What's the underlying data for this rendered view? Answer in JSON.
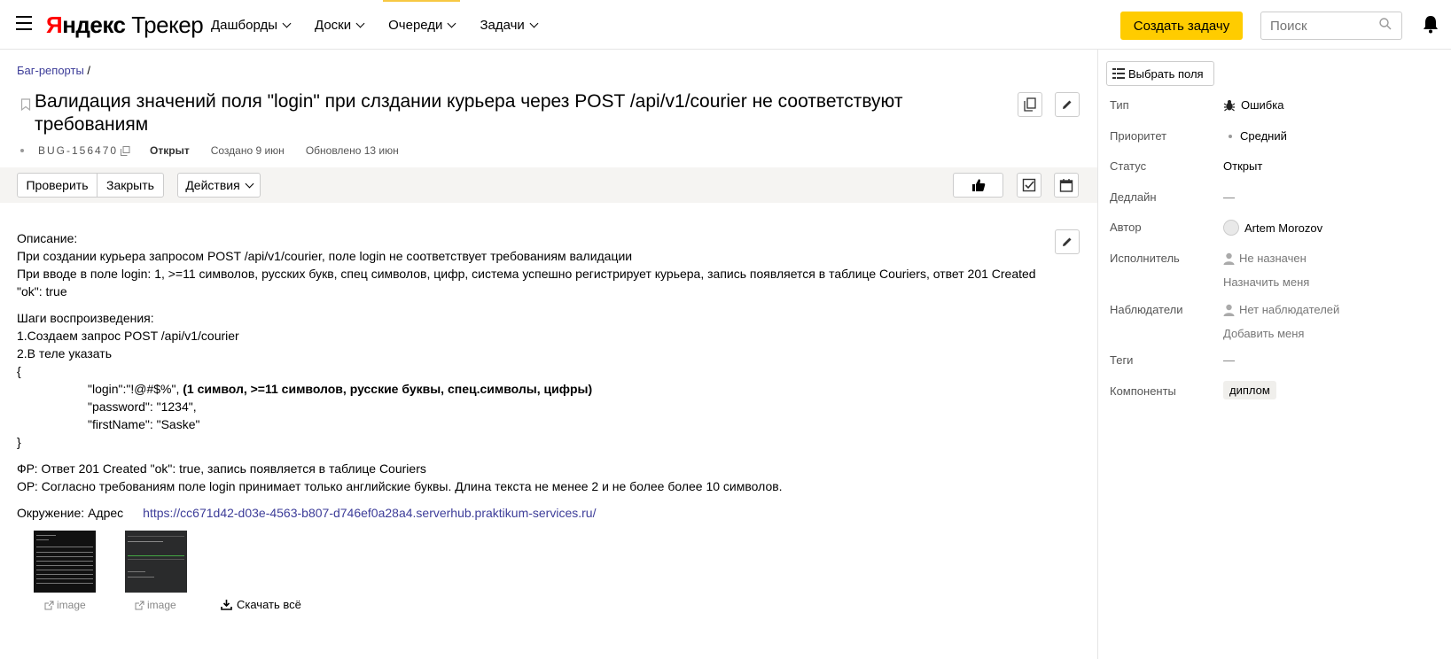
{
  "header": {
    "logo_yandex": "Яндекс",
    "logo_tracker": "Трекер",
    "nav": [
      {
        "label": "Дашборды"
      },
      {
        "label": "Доски"
      },
      {
        "label": "Очереди"
      },
      {
        "label": "Задачи"
      }
    ],
    "create_label": "Создать задачу",
    "search_placeholder": "Поиск"
  },
  "issue": {
    "breadcrumb_queue": "Баг-репорты",
    "breadcrumb_sep": " /",
    "title": "Валидация значений поля \"login\" при слздании курьера через POST /api/v1/courier не соответствуют требованиям",
    "key": "BUG-156470",
    "status": "Открыт",
    "created": "Создано 9 июн",
    "updated": "Обновлено 13 июн"
  },
  "actions": {
    "check": "Проверить",
    "close": "Закрыть",
    "actions": "Действия"
  },
  "description": {
    "l1": "Описание:",
    "l2": "При создании курьера запросом POST /api/v1/courier, поле login не соответствует требованиям валидации",
    "l3": "При вводе в поле login: 1, >=11 символов, русских букв, спец символов, цифр, система успешно регистрирует курьера, запись появляется в таблице Couriers, ответ 201 Created",
    "l4": "\"ok\": true",
    "s1": "Шаги воспроизведения:",
    "s2": "1.Создаем запрос POST /api/v1/courier",
    "s3": "2.В теле указать",
    "s4": "{",
    "s5a": "\"login\":\"!@#$%\", ",
    "s5b": "(1 символ, >=11 символов, русские буквы, спец.символы, цифры)",
    "s6": "\"password\": \"1234\",",
    "s7": "\"firstName\": \"Saske\"",
    "s8": "}",
    "fr": "ФР: Ответ 201 Created \"ok\": true, запись появляется в таблице Couriers",
    "or": "ОР: Согласно требованиям поле login принимает только английские буквы. Длина текста не менее 2 и не более более 10 символов.",
    "env_label": "Окружение: Адрес",
    "env_link": "https://cc671d42-d03e-4563-b807-d746ef0a28a4.serverhub.praktikum-services.ru/"
  },
  "attachments": {
    "items": [
      {
        "label": "image"
      },
      {
        "label": "image"
      }
    ],
    "download_all": "Скачать всё"
  },
  "sidebar": {
    "fields_button": "Выбрать поля",
    "type_label": "Тип",
    "type_value": "Ошибка",
    "priority_label": "Приоритет",
    "priority_value": "Средний",
    "status_label": "Статус",
    "status_value": "Открыт",
    "deadline_label": "Дедлайн",
    "deadline_value": "—",
    "author_label": "Автор",
    "author_value": "Artem Morozov",
    "assignee_label": "Исполнитель",
    "assignee_value": "Не назначен",
    "assign_me": "Назначить меня",
    "followers_label": "Наблюдатели",
    "followers_value": "Нет наблюдателей",
    "add_me": "Добавить меня",
    "tags_label": "Теги",
    "tags_value": "—",
    "components_label": "Компоненты",
    "components_value": "диплом"
  }
}
